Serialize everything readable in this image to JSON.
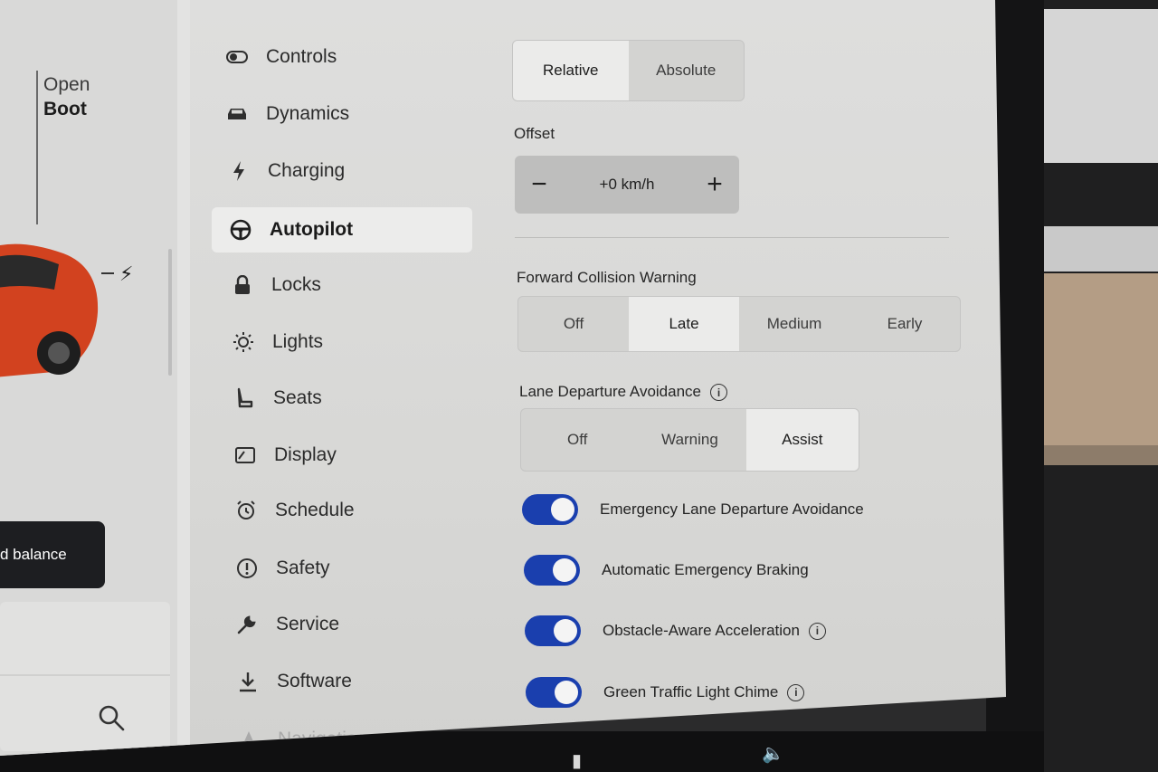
{
  "left_panel": {
    "open_label": "Open",
    "boot_label": "Boot",
    "toast_text": "d balance"
  },
  "nav": {
    "items": [
      {
        "label": "Controls",
        "icon": "toggle-icon"
      },
      {
        "label": "Dynamics",
        "icon": "car-icon"
      },
      {
        "label": "Charging",
        "icon": "bolt-icon"
      },
      {
        "label": "Autopilot",
        "icon": "steering-wheel-icon",
        "active": true
      },
      {
        "label": "Locks",
        "icon": "lock-icon"
      },
      {
        "label": "Lights",
        "icon": "sun-icon"
      },
      {
        "label": "Seats",
        "icon": "seat-icon"
      },
      {
        "label": "Display",
        "icon": "display-icon"
      },
      {
        "label": "Schedule",
        "icon": "alarm-clock-icon"
      },
      {
        "label": "Safety",
        "icon": "exclamation-circle-icon"
      },
      {
        "label": "Service",
        "icon": "wrench-icon"
      },
      {
        "label": "Software",
        "icon": "download-icon"
      },
      {
        "label": "Navigation",
        "icon": "navigation-arrow-icon"
      }
    ]
  },
  "speed_limit": {
    "options": [
      "Relative",
      "Absolute"
    ],
    "selected": "Relative"
  },
  "offset": {
    "label": "Offset",
    "value": "+0 km/h",
    "minus": "−",
    "plus": "+"
  },
  "forward_collision": {
    "label": "Forward Collision Warning",
    "options": [
      "Off",
      "Late",
      "Medium",
      "Early"
    ],
    "selected": "Late"
  },
  "lane_departure": {
    "label": "Lane Departure Avoidance",
    "options": [
      "Off",
      "Warning",
      "Assist"
    ],
    "selected": "Assist"
  },
  "toggles": [
    {
      "label": "Emergency Lane Departure Avoidance",
      "on": true,
      "info": false
    },
    {
      "label": "Automatic Emergency Braking",
      "on": true,
      "info": false
    },
    {
      "label": "Obstacle-Aware Acceleration",
      "on": true,
      "info": true
    },
    {
      "label": "Green Traffic Light Chime",
      "on": true,
      "info": true
    }
  ],
  "colors": {
    "toggle_on": "#1a3fae",
    "selected_segment": "#ebebea",
    "screen_bg": "#d8d8d6"
  }
}
